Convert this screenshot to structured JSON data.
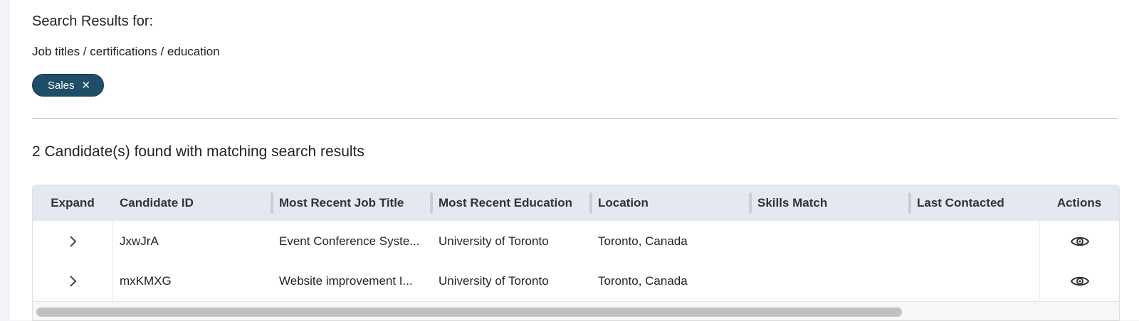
{
  "search": {
    "heading": "Search Results for:",
    "filter_category": "Job titles / certifications / education",
    "chips": [
      {
        "label": "Sales",
        "remove_icon": "close-icon"
      }
    ]
  },
  "results": {
    "count_text": "2 Candidate(s) found with matching search results"
  },
  "table": {
    "columns": {
      "expand": "Expand",
      "candidate_id": "Candidate ID",
      "job_title": "Most Recent Job Title",
      "education": "Most Recent Education",
      "location": "Location",
      "skills_match": "Skills Match",
      "last_contacted": "Last Contacted",
      "actions": "Actions"
    },
    "rows": [
      {
        "candidate_id": "JxwJrA",
        "job_title": "Event Conference Syste...",
        "education": "University of Toronto",
        "location": "Toronto, Canada",
        "skills_match": "",
        "last_contacted": ""
      },
      {
        "candidate_id": "mxKMXG",
        "job_title": "Website improvement I...",
        "education": "University of Toronto",
        "location": "Toronto, Canada",
        "skills_match": "",
        "last_contacted": ""
      }
    ]
  },
  "colors": {
    "chip_bg": "#1f4e68",
    "header_bg": "#e4e9f1",
    "page_bg": "#f3f4f7"
  }
}
